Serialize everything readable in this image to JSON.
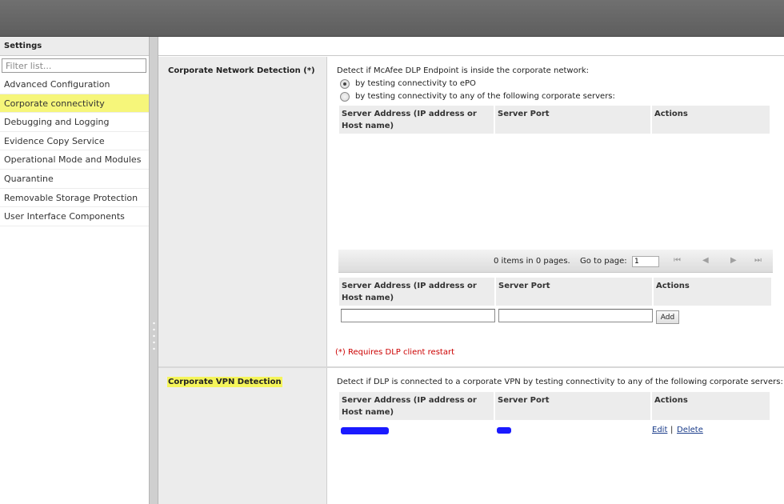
{
  "sidebar": {
    "title": "Settings",
    "filter_placeholder": "Filter list...",
    "items": [
      {
        "label": "Advanced Configuration"
      },
      {
        "label": "Corporate connectivity"
      },
      {
        "label": "Debugging and Logging"
      },
      {
        "label": "Evidence Copy Service"
      },
      {
        "label": "Operational Mode and Modules"
      },
      {
        "label": "Quarantine"
      },
      {
        "label": "Removable Storage Protection"
      },
      {
        "label": "User Interface Components"
      }
    ],
    "selected_index": 1,
    "highlight_color": "#f6f67a"
  },
  "network_section": {
    "label": "Corporate Network Detection (*)",
    "description": "Detect if McAfee DLP Endpoint is inside the corporate network:",
    "options": [
      {
        "label": "by testing connectivity to ePO",
        "checked": true
      },
      {
        "label": "by testing connectivity to any of the following corporate servers:",
        "checked": false
      }
    ],
    "table_headers": {
      "server": "Server Address (IP address or Host name)",
      "port": "Server Port",
      "actions": "Actions"
    },
    "pager": {
      "items_text": "0 items in 0 pages.",
      "goto_label": "Go to page:",
      "page_value": "1"
    },
    "add_button": "Add",
    "restart_note": "(*) Requires DLP client restart",
    "note_color": "#cc0000"
  },
  "vpn_section": {
    "label": "Corporate VPN Detection",
    "description": "Detect if DLP is connected to a corporate VPN by testing connectivity to any of the following corporate servers:",
    "table_headers": {
      "server": "Server Address (IP address or Host name)",
      "port": "Server Port",
      "actions": "Actions"
    },
    "row_actions": {
      "edit": "Edit",
      "separator": "|",
      "delete": "Delete"
    },
    "redaction_color": "#1a1aff"
  },
  "icons": {
    "first": "first-page-icon",
    "prev": "previous-page-icon",
    "next": "next-page-icon",
    "last": "last-page-icon"
  }
}
